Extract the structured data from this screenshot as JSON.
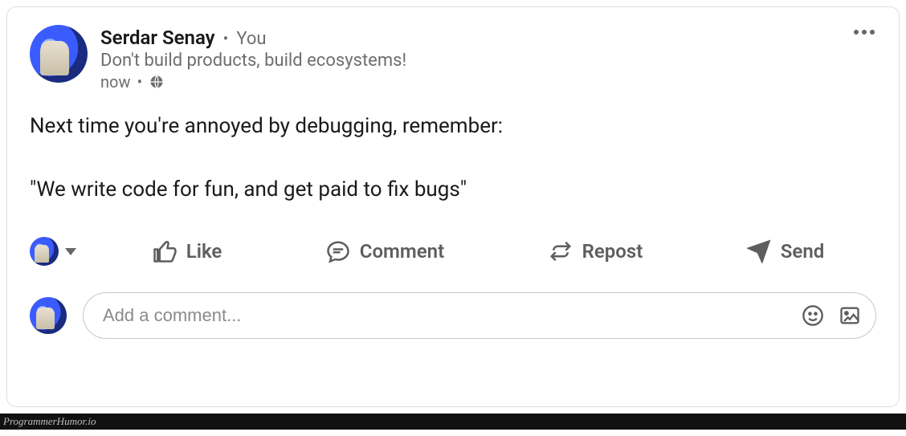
{
  "post": {
    "author": {
      "name": "Serdar Senay",
      "relation": "You",
      "tagline": "Don't build products, build ecosystems!",
      "time": "now"
    },
    "body_line1": "Next time you're annoyed by debugging, remember:",
    "body_line2": "\"We write code for fun, and get paid to fix bugs\""
  },
  "actions": {
    "like": "Like",
    "comment": "Comment",
    "repost": "Repost",
    "send": "Send"
  },
  "comment_box": {
    "placeholder": "Add a comment..."
  },
  "footer": {
    "watermark": "ProgrammerHumor.io"
  }
}
